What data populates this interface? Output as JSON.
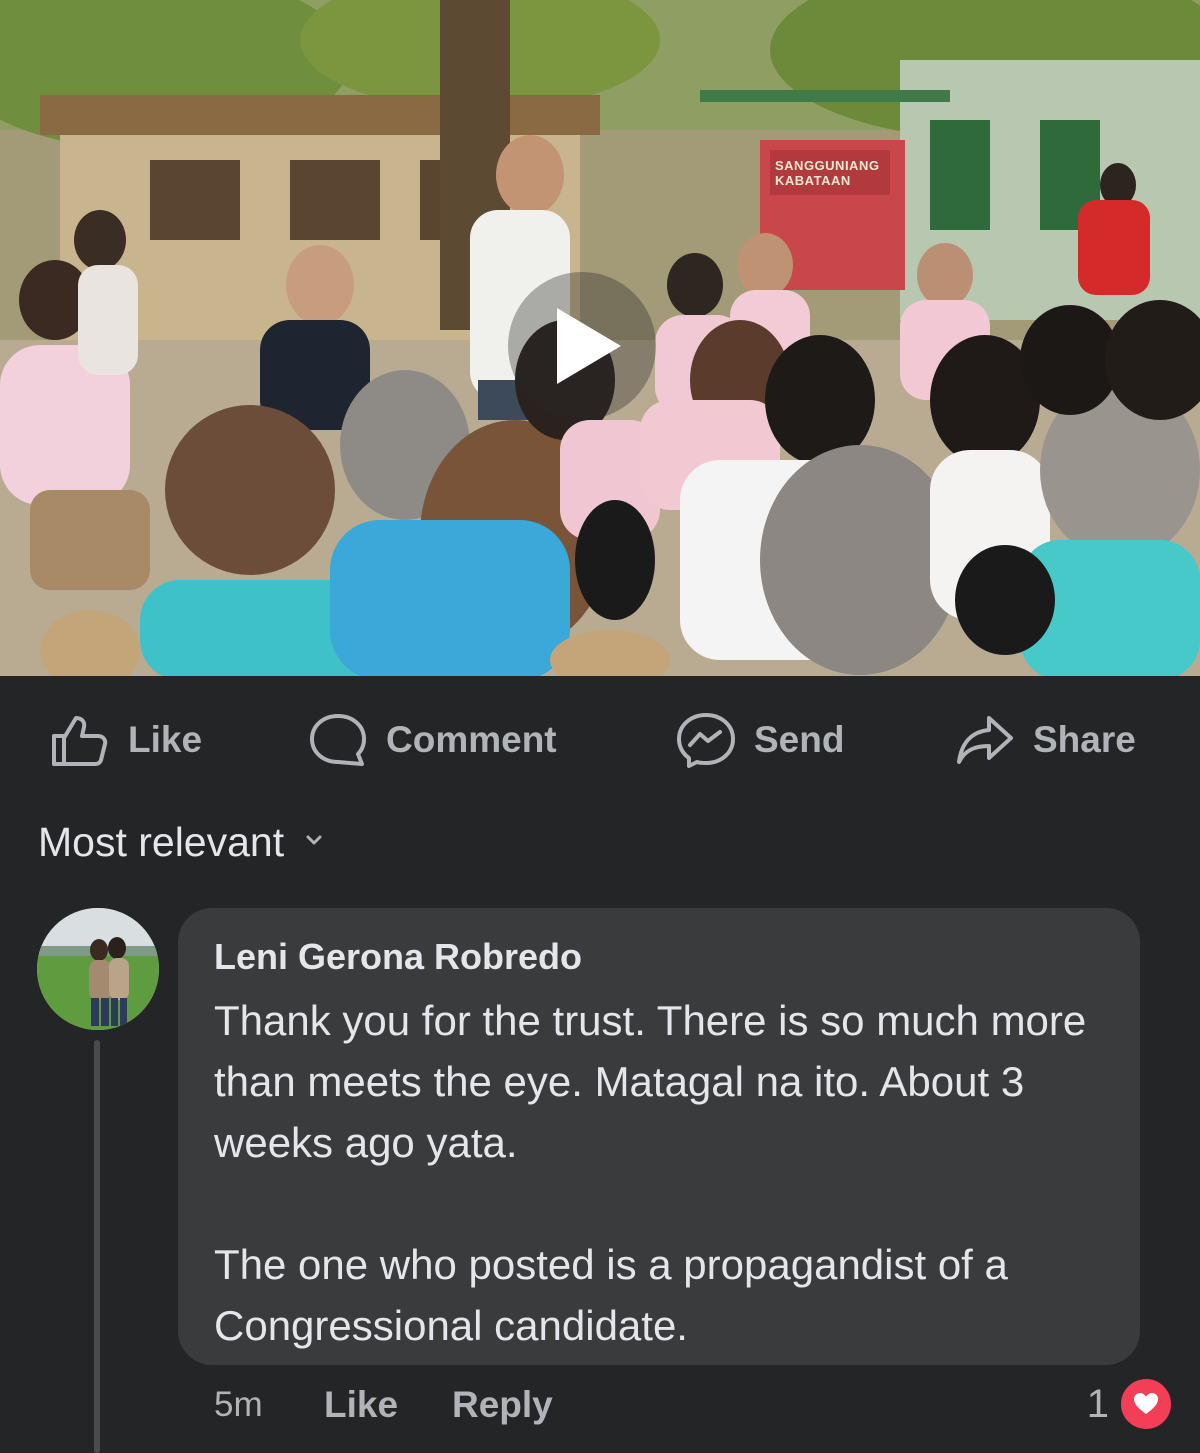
{
  "video": {
    "sign_line1": "SANGGUNIANG",
    "sign_line2": "KABATAAN",
    "play_icon": "play-icon"
  },
  "actions": {
    "like_label": "Like",
    "comment_label": "Comment",
    "send_label": "Send",
    "share_label": "Share",
    "icons": [
      "thumbs-up-icon",
      "comment-bubble-icon",
      "messenger-icon",
      "share-arrow-icon"
    ]
  },
  "sort": {
    "label": "Most relevant",
    "icon": "chevron-down-icon"
  },
  "comment": {
    "author": "Leni Gerona Robredo",
    "paragraph1": "Thank you for the trust. There is so much more than meets the eye. Matagal na ito. About 3 weeks ago yata.",
    "paragraph2": "The one who posted is a propagandist of a Congressional candidate.",
    "time": "5m",
    "like_label": "Like",
    "reply_label": "Reply",
    "reaction_count": "1",
    "reaction_icon": "heart-icon"
  },
  "colors": {
    "background": "#242526",
    "bubble": "#3a3b3c",
    "text_primary": "#e4e6eb",
    "text_secondary": "#b0b3b8",
    "heart": "#f33e58"
  }
}
